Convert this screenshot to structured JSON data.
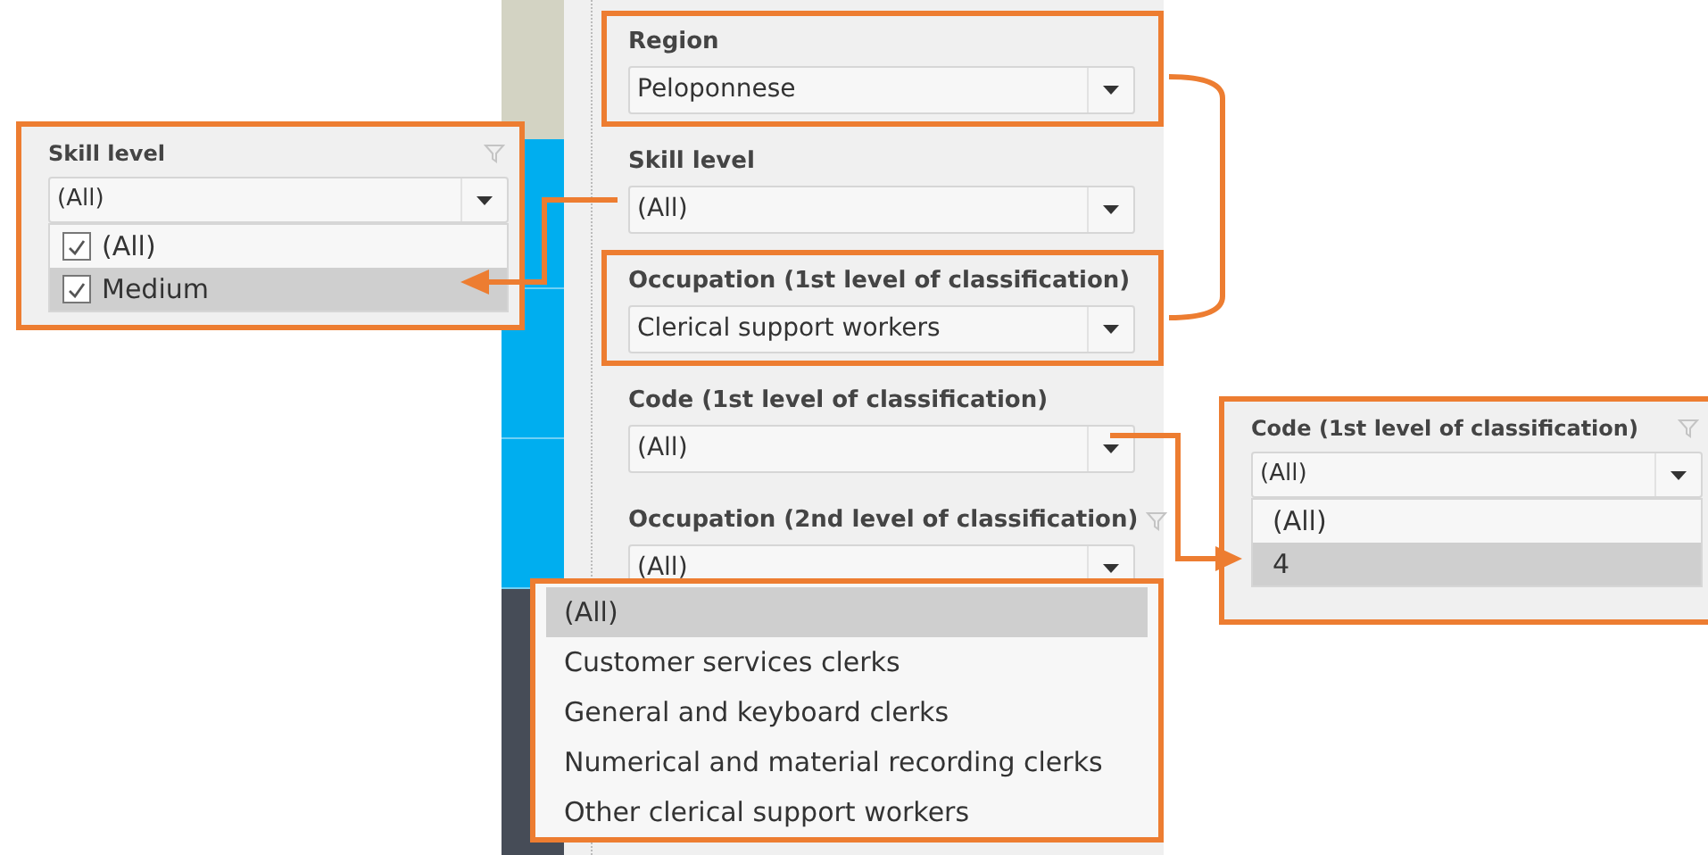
{
  "filters": [
    {
      "label": "Region",
      "value": "Peloponnese",
      "highlighted": true,
      "filter_icon": false
    },
    {
      "label": "Skill level",
      "value": "(All)",
      "highlighted": false,
      "filter_icon": false
    },
    {
      "label": "Occupation (1st level of classification)",
      "value": "Clerical support workers",
      "highlighted": true,
      "filter_icon": false
    },
    {
      "label": "Code (1st level of classification)",
      "value": "(All)",
      "highlighted": false,
      "filter_icon": false
    },
    {
      "label": "Occupation (2nd level of classification)",
      "value": "(All)",
      "highlighted": false,
      "filter_icon": true
    }
  ],
  "open_list": {
    "items": [
      {
        "label": "(All)",
        "selected": true
      },
      {
        "label": "Customer services clerks",
        "selected": false
      },
      {
        "label": "General and keyboard clerks",
        "selected": false
      },
      {
        "label": "Numerical and material recording clerks",
        "selected": false
      },
      {
        "label": "Other clerical support workers",
        "selected": false
      }
    ]
  },
  "callouts": [
    {
      "kind": "checklist",
      "label": "Skill level",
      "value": "(All)",
      "filter_icon": true,
      "items": [
        {
          "label": "(All)",
          "checked": true,
          "highlighted": false
        },
        {
          "label": "Medium",
          "checked": true,
          "highlighted": true
        }
      ]
    },
    {
      "kind": "list",
      "label": "Code (1st level of classification)",
      "value": "(All)",
      "filter_icon": true,
      "items": [
        {
          "label": "(All)",
          "highlighted": false
        },
        {
          "label": "4",
          "highlighted": true
        }
      ]
    }
  ]
}
